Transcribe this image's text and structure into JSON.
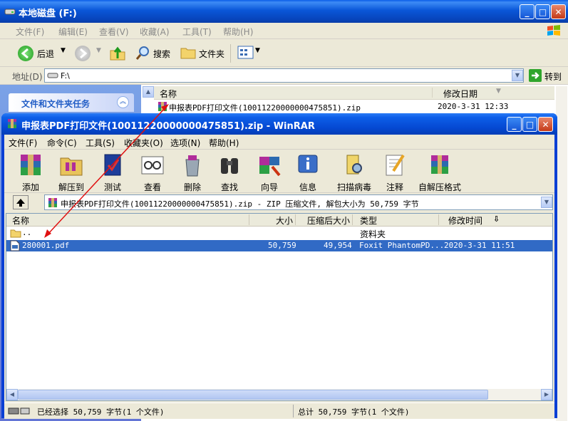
{
  "explorer": {
    "title": "本地磁盘 (F:)",
    "menu": [
      "文件(F)",
      "编辑(E)",
      "查看(V)",
      "收藏(A)",
      "工具(T)",
      "帮助(H)"
    ],
    "toolbar": {
      "back": "后退",
      "search": "搜索",
      "folders": "文件夹"
    },
    "address_label": "地址(D)",
    "address_value": "F:\\",
    "go_label": "转到",
    "task_pane_title": "文件和文件夹任务",
    "columns": {
      "name": "名称",
      "modified": "修改日期"
    },
    "file": {
      "name": "申报表PDF打印文件(10011220000000475851).zip",
      "modified": "2020-3-31 12:33"
    }
  },
  "winrar": {
    "title": "申报表PDF打印文件(10011220000000475851).zip - WinRAR",
    "menu": [
      "文件(F)",
      "命令(C)",
      "工具(S)",
      "收藏夹(O)",
      "选项(N)",
      "帮助(H)"
    ],
    "tools": [
      "添加",
      "解压到",
      "测试",
      "查看",
      "删除",
      "查找",
      "向导",
      "信息",
      "扫描病毒",
      "注释",
      "自解压格式"
    ],
    "path": "申报表PDF打印文件(10011220000000475851).zip - ZIP 压缩文件, 解包大小为 50,759 字节",
    "columns": {
      "name": "名称",
      "size": "大小",
      "packed": "压缩后大小",
      "type": "类型",
      "modified": "修改时间"
    },
    "rows": [
      {
        "name": "..",
        "size": "",
        "packed": "",
        "type": "资料夹",
        "modified": ""
      },
      {
        "name": "280001.pdf",
        "size": "50,759",
        "packed": "49,954",
        "type": "Foxit PhantomPD...",
        "modified": "2020-3-31 11:51"
      }
    ],
    "status_left": "已经选择 50,759 字节(1 个文件)",
    "status_right": "总计 50,759 字节(1 个文件)"
  },
  "colors": {
    "xp_blue": "#0a5ee8",
    "selection": "#316ac5",
    "arrow": "#e01010"
  }
}
